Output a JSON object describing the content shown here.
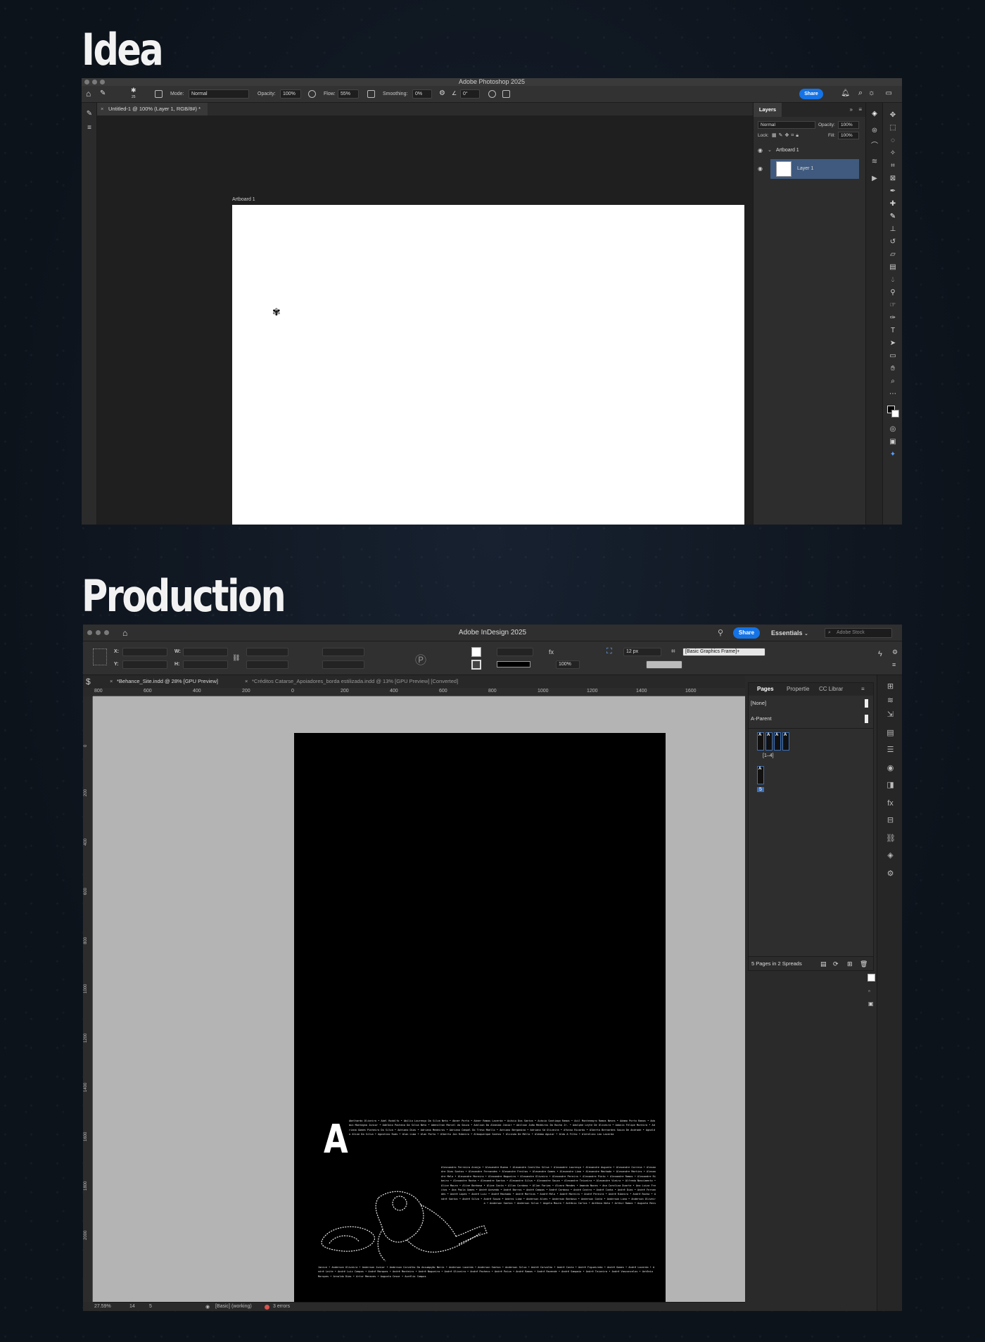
{
  "sections": {
    "idea_title": "Idea",
    "production_title": "Production"
  },
  "photoshop": {
    "app_title": "Adobe Photoshop 2025",
    "options": {
      "brush_size": "25",
      "mode_label": "Mode:",
      "mode_value": "Normal",
      "opacity_label": "Opacity:",
      "opacity_value": "100%",
      "flow_label": "Flow:",
      "flow_value": "55%",
      "smoothing_label": "Smoothing:",
      "smoothing_value": "0%",
      "angle_value": "0°",
      "share_label": "Share"
    },
    "tab_title": "Untitled-1 @ 100% (Layer 1, RGB/8#) *",
    "artboard_label": "Artboard 1",
    "layers_panel": {
      "tab": "Layers",
      "blend_mode": "Normal",
      "opacity_label": "Opacity:",
      "opacity_value": "100%",
      "lock_label": "Lock:",
      "fill_label": "Fill:",
      "fill_value": "100%",
      "artboard_row": "Artboard 1",
      "layer_row": "Layer 1"
    }
  },
  "indesign": {
    "app_title": "Adobe InDesign 2025",
    "share_label": "Share",
    "workspace": "Essentials",
    "stock_placeholder": "Adobe Stock",
    "control": {
      "x_label": "X:",
      "y_label": "Y:",
      "w_label": "W:",
      "h_label": "H:",
      "zoom_value": "100%",
      "stroke_weight": "12 px",
      "object_style": "[Basic Graphics Frame]+"
    },
    "tabs": [
      "*Behance_Site.indd @ 28% [GPU Preview]",
      "*Créditos Catarse_Apoiadores_borda estilizada.indd @ 13% [GPU Preview] [Converted]"
    ],
    "ruler_h": [
      "800",
      "600",
      "400",
      "200",
      "0",
      "200",
      "400",
      "600",
      "800",
      "1000",
      "1200",
      "1400",
      "1600"
    ],
    "ruler_v": [
      "0",
      "200",
      "400",
      "600",
      "800",
      "1000",
      "1200",
      "1400",
      "1600",
      "1800",
      "2000"
    ],
    "page": {
      "dropcap": "A",
      "credits_intro": "Abelhardo Oliveira • Abel Rodolfo • Abílio Lourenço Da Silva Neto • Abner Porto • Abner Ramos Lacerda • Acácio Dos Santos • Acácio Santiago Ramos • Acil Montenegro Ramos Neves • Adamo Porto Ramos • Adamus Montagna Junior • Adelbio Pacheco Da Silva Neto • Adenilton Marcel da Souza • Adilson Da Almeida Júnior • Adilson João Medeiros Do Rocha Jr. • Adolphe Leyte De Oliveira • Adonis Felipe Moreira • Adriana Gomes Pinheiro Do Silva • Adriano Dias • Adriano Medeiros • Adriano Campel Do Trevo Moello • Adriano Bergamina • Adriano Sá Oliveira • Afonso Ricardo • Alberto Bernardes Souza De Andrade • Agnaldo Aline Da Silva • Agostino Ruás • Alan Lima • Alan Porto • Alberto Jan Ribeiro • Albuquerque Santos • Alcindo De Mello • Aldemo Aguiar • Aldo A Filho • Aldrelino Leo Lacerda",
      "credits_right": "Alessandro Ferreira Araújo • Alexandre Bueno • Alexandre Castilho Silva • Alexandre Lourenço • Alexandre Augusto • Alexandre Correia • Alexandre Dias Santos • Alexandre Fernandes • Alexandre Freitas • Alexandre Gomes • Alexandre Lima • Alexandre Machado • Alexandre Martins • Alexandre Melo • Alexandre Moreira • Alexandre Nogueira • Alexandre Oliveira • Alexandre Pereira • Alexandre Pinto • Alexandre Ramos • Alexandre Ribeiro • Alexandre Rocha • Alexandre Santos • Alexandre Silva • Alexandre Souza • Alexandre Teixeira • Alexandre Vieira • Alfredo Nascimento • Alice Moura • Aline Barbosa • Aline Costa • Allan Cardoso • Allan Farias • Alvaro Mendes • Amanda Nunes • Ana Carolina Duarte • Ana Luiza Freitas • Ana Paula Gomes • André Azevedo • André Barros • André Campos • André Cardoso • André Castro • André Cunha • André Dias • André Fernandes • André Lopes • André Luiz • André Machado • André Martins • André Melo • André Moreira • André Pereira • André Ribeiro • André Rocha • André Santos • André Silva • André Souza • Andrei Lima • Anderson Alves • Anderson Barbosa • Anderson Costa • Anderson Lima • Anderson Oliveira • Anderson Santos • Anderson Silva • Angelo Moura • Antônio Carlos • Antônio Neto • Arthur Ramos • Augusto Reis",
      "credits_bottom": "Janice • Anderson Oliveira • Anderson Junior • Anderson Carvalho Da Assumpção Neris • Anderson Lacerda • Anderson Santos • Anderson Silva • André Carvalho • André Costa • André Figueiredo • André Gomes • André Lacerda • André Leite • André Luiz Campos • André Marques • André Monteiro • André Nogueira • André Oliveira • André Pacheco • André Paiva • André Ramos • André Rezende • André Sampaio • André Teixeira • André Vasconcelos • Antônio Marques • Arnaldo Dias • Artur Menezes • Augusto Cesar • Aurélio Campos"
    },
    "status": {
      "zoom": "27.59%",
      "page": "14",
      "page_total": "5",
      "preflight_profile": "[Basic] (working)",
      "errors": "3 errors"
    },
    "pages_panel": {
      "tabs": [
        "Pages",
        "Propertie",
        "CC Librar"
      ],
      "none_row": "[None]",
      "parent_row": "A-Parent",
      "spread1_label": "[1–4]",
      "spread2_label": "5",
      "footer": "5 Pages in 2 Spreads"
    }
  },
  "colors": {
    "share_blue": "#1473e6",
    "selected_layer": "#3f5a7e",
    "page_bg": "#000000",
    "pasteboard": "#b4b4b4"
  }
}
